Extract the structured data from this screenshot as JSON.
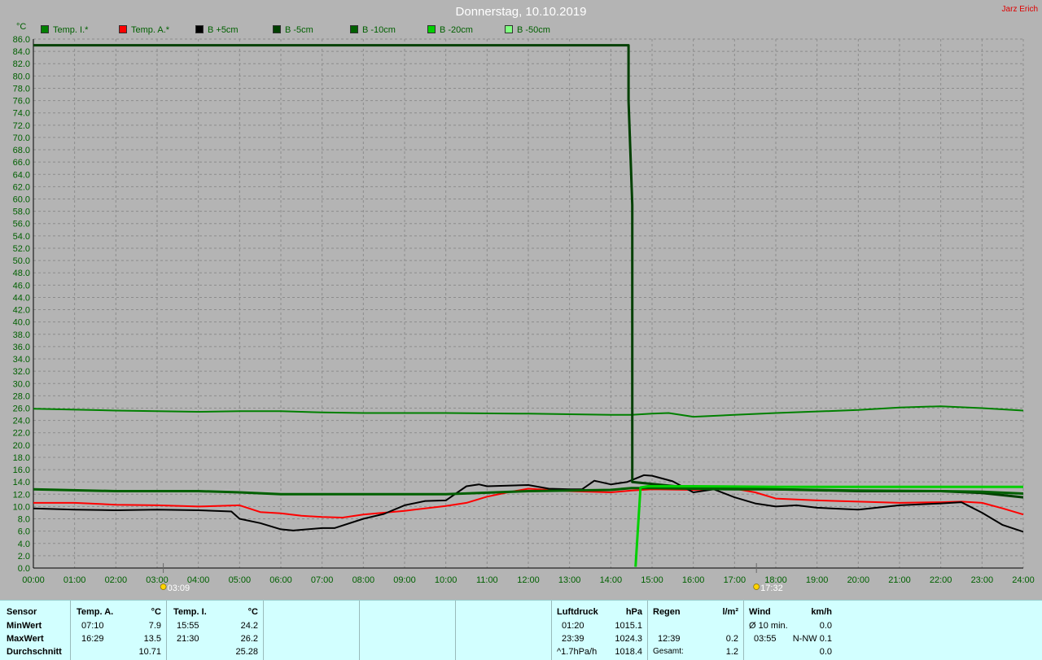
{
  "header": {
    "title": "Donnerstag, 10.10.2019",
    "author": "Jarz Erich"
  },
  "legend": [
    {
      "label": "Temp. I.*",
      "color": "#008000"
    },
    {
      "label": "Temp. A.*",
      "color": "#ff0000"
    },
    {
      "label": "B +5cm",
      "color": "#000000"
    },
    {
      "label": "B -5cm",
      "color": "#004000"
    },
    {
      "label": "B -10cm",
      "color": "#006000"
    },
    {
      "label": "B -20cm",
      "color": "#00d000"
    },
    {
      "label": "B -50cm",
      "color": "#80ff80"
    }
  ],
  "chart_data": {
    "type": "line",
    "ylabel": "°C",
    "ylim": [
      0,
      86
    ],
    "xlim": [
      0,
      24
    ],
    "y_ticks": [
      "0.0",
      "2.0",
      "4.0",
      "6.0",
      "8.0",
      "10.0",
      "12.0",
      "14.0",
      "16.0",
      "18.0",
      "20.0",
      "22.0",
      "24.0",
      "26.0",
      "28.0",
      "30.0",
      "32.0",
      "34.0",
      "36.0",
      "38.0",
      "40.0",
      "42.0",
      "44.0",
      "46.0",
      "48.0",
      "50.0",
      "52.0",
      "54.0",
      "56.0",
      "58.0",
      "60.0",
      "62.0",
      "64.0",
      "66.0",
      "68.0",
      "70.0",
      "72.0",
      "74.0",
      "76.0",
      "78.0",
      "80.0",
      "82.0",
      "84.0",
      "86.0"
    ],
    "x_ticks": [
      "00:00",
      "01:00",
      "02:00",
      "03:00",
      "04:00",
      "05:00",
      "06:00",
      "07:00",
      "08:00",
      "09:00",
      "10:00",
      "11:00",
      "12:00",
      "13:00",
      "14:00",
      "15:00",
      "16:00",
      "17:00",
      "18:00",
      "19:00",
      "20:00",
      "21:00",
      "22:00",
      "23:00",
      "24:00"
    ],
    "markers": [
      {
        "label": "03:09",
        "x": 3.15,
        "icon": "sunrise-icon"
      },
      {
        "label": "17:32",
        "x": 17.53,
        "icon": "sunset-icon"
      }
    ],
    "grid": true,
    "legend_position": "top-left",
    "series": [
      {
        "name": "Temp. I.*",
        "color": "#008000",
        "width": 2,
        "x": [
          0,
          2,
          4,
          5,
          6,
          7,
          8,
          10,
          12,
          14,
          14.5,
          15,
          15.4,
          16,
          17,
          18,
          20,
          21,
          22,
          23,
          24
        ],
        "y": [
          25.9,
          25.6,
          25.4,
          25.5,
          25.5,
          25.3,
          25.2,
          25.2,
          25.1,
          24.9,
          24.9,
          25.1,
          25.2,
          24.6,
          24.9,
          25.2,
          25.7,
          26.1,
          26.3,
          26.0,
          25.6
        ]
      },
      {
        "name": "Temp. A.*",
        "color": "#ff0000",
        "width": 2,
        "x": [
          0,
          1,
          2,
          3,
          4,
          5,
          5.5,
          6,
          6.5,
          7,
          7.5,
          8,
          9,
          10,
          10.5,
          11,
          11.5,
          12,
          13,
          14,
          14.5,
          15,
          16,
          17,
          17.5,
          18,
          19,
          20,
          21,
          22,
          22.5,
          23,
          23.5,
          24
        ],
        "y": [
          10.6,
          10.6,
          10.3,
          10.2,
          10.0,
          10.2,
          9.1,
          8.9,
          8.5,
          8.3,
          8.2,
          8.7,
          9.3,
          10.1,
          10.6,
          11.6,
          12.3,
          12.9,
          12.5,
          12.3,
          12.6,
          12.8,
          12.7,
          12.9,
          12.3,
          11.3,
          11.0,
          10.8,
          10.6,
          10.7,
          10.8,
          10.6,
          9.7,
          8.7
        ]
      },
      {
        "name": "B +5cm",
        "color": "#000000",
        "width": 2,
        "x": [
          0,
          1,
          2,
          3,
          4,
          4.8,
          5,
          5.5,
          6,
          6.3,
          7,
          7.3,
          8,
          8.5,
          9,
          9.5,
          10,
          10.5,
          10.8,
          11,
          11.5,
          12,
          12.5,
          13,
          13.3,
          13.6,
          14,
          14.4,
          14.8,
          15,
          15.5,
          16,
          16.5,
          17,
          17.5,
          18,
          18.5,
          19,
          20,
          21,
          22,
          22.5,
          23,
          23.5,
          24
        ],
        "y": [
          9.7,
          9.5,
          9.4,
          9.5,
          9.4,
          9.2,
          8.0,
          7.3,
          6.3,
          6.1,
          6.5,
          6.5,
          8.0,
          8.8,
          10.2,
          10.9,
          11.0,
          13.3,
          13.6,
          13.3,
          13.4,
          13.5,
          12.9,
          12.8,
          12.8,
          14.2,
          13.6,
          14.0,
          15.1,
          15.0,
          14.1,
          12.3,
          12.8,
          11.5,
          10.5,
          10.0,
          10.2,
          9.8,
          9.5,
          10.2,
          10.5,
          10.7,
          9.0,
          7.0,
          5.9
        ]
      },
      {
        "name": "B -5cm",
        "color": "#004000",
        "width": 3,
        "x": [
          0,
          14.43,
          14.43,
          14.52,
          14.52,
          16,
          18,
          20,
          22,
          23,
          24
        ],
        "y": [
          85,
          85,
          76,
          59,
          14.0,
          13.0,
          12.8,
          12.5,
          12.5,
          12.2,
          11.5
        ]
      },
      {
        "name": "B -10cm",
        "color": "#006000",
        "width": 3,
        "x": [
          0,
          2,
          4,
          5,
          6,
          8,
          10,
          12,
          13,
          14,
          14.5,
          15,
          16,
          17,
          18,
          20,
          22,
          23,
          24
        ],
        "y": [
          12.8,
          12.5,
          12.5,
          12.3,
          12.0,
          12.0,
          12.0,
          12.5,
          12.6,
          12.7,
          13.0,
          13.0,
          12.9,
          12.8,
          12.8,
          12.6,
          12.5,
          12.4,
          12.1
        ]
      },
      {
        "name": "B -20cm",
        "color": "#00d000",
        "width": 3,
        "x": [
          14.6,
          14.72,
          14.9,
          16,
          18,
          20,
          22,
          24
        ],
        "y": [
          0.2,
          13.1,
          13.3,
          13.3,
          13.2,
          13.2,
          13.2,
          13.2
        ]
      }
    ]
  },
  "stats": {
    "sensor": {
      "h": "Sensor",
      "r1": "MinWert",
      "r2": "MaxWert",
      "r3": "Durchschnitt"
    },
    "temp_a": {
      "h": "Temp. A.",
      "unit": "°C",
      "min_time": "07:10",
      "min_val": "7.9",
      "max_time": "16:29",
      "max_val": "13.5",
      "avg": "10.71"
    },
    "temp_i": {
      "h": "Temp. I.",
      "unit": "°C",
      "min_time": "15:55",
      "min_val": "24.2",
      "max_time": "21:30",
      "max_val": "26.2",
      "avg": "25.28"
    },
    "pressure": {
      "h": "Luftdruck",
      "unit": "hPa",
      "min_time": "01:20",
      "min_val": "1015.1",
      "max_time": "23:39",
      "max_val": "1024.3",
      "trend_label": "^1.7hPa/h",
      "trend_val": "1018.4"
    },
    "rain": {
      "h": "Regen",
      "unit": "l/m²",
      "max_time": "12:39",
      "max_val": "0.2",
      "total_label": "Gesamt:",
      "total_val": "1.2"
    },
    "wind": {
      "h": "Wind",
      "unit": "km/h",
      "avg_label": "Ø 10 min.",
      "avg_val": "0.0",
      "max_time": "03:55",
      "max_val": "N-NW 0.1",
      "r3_val": "0.0"
    }
  }
}
